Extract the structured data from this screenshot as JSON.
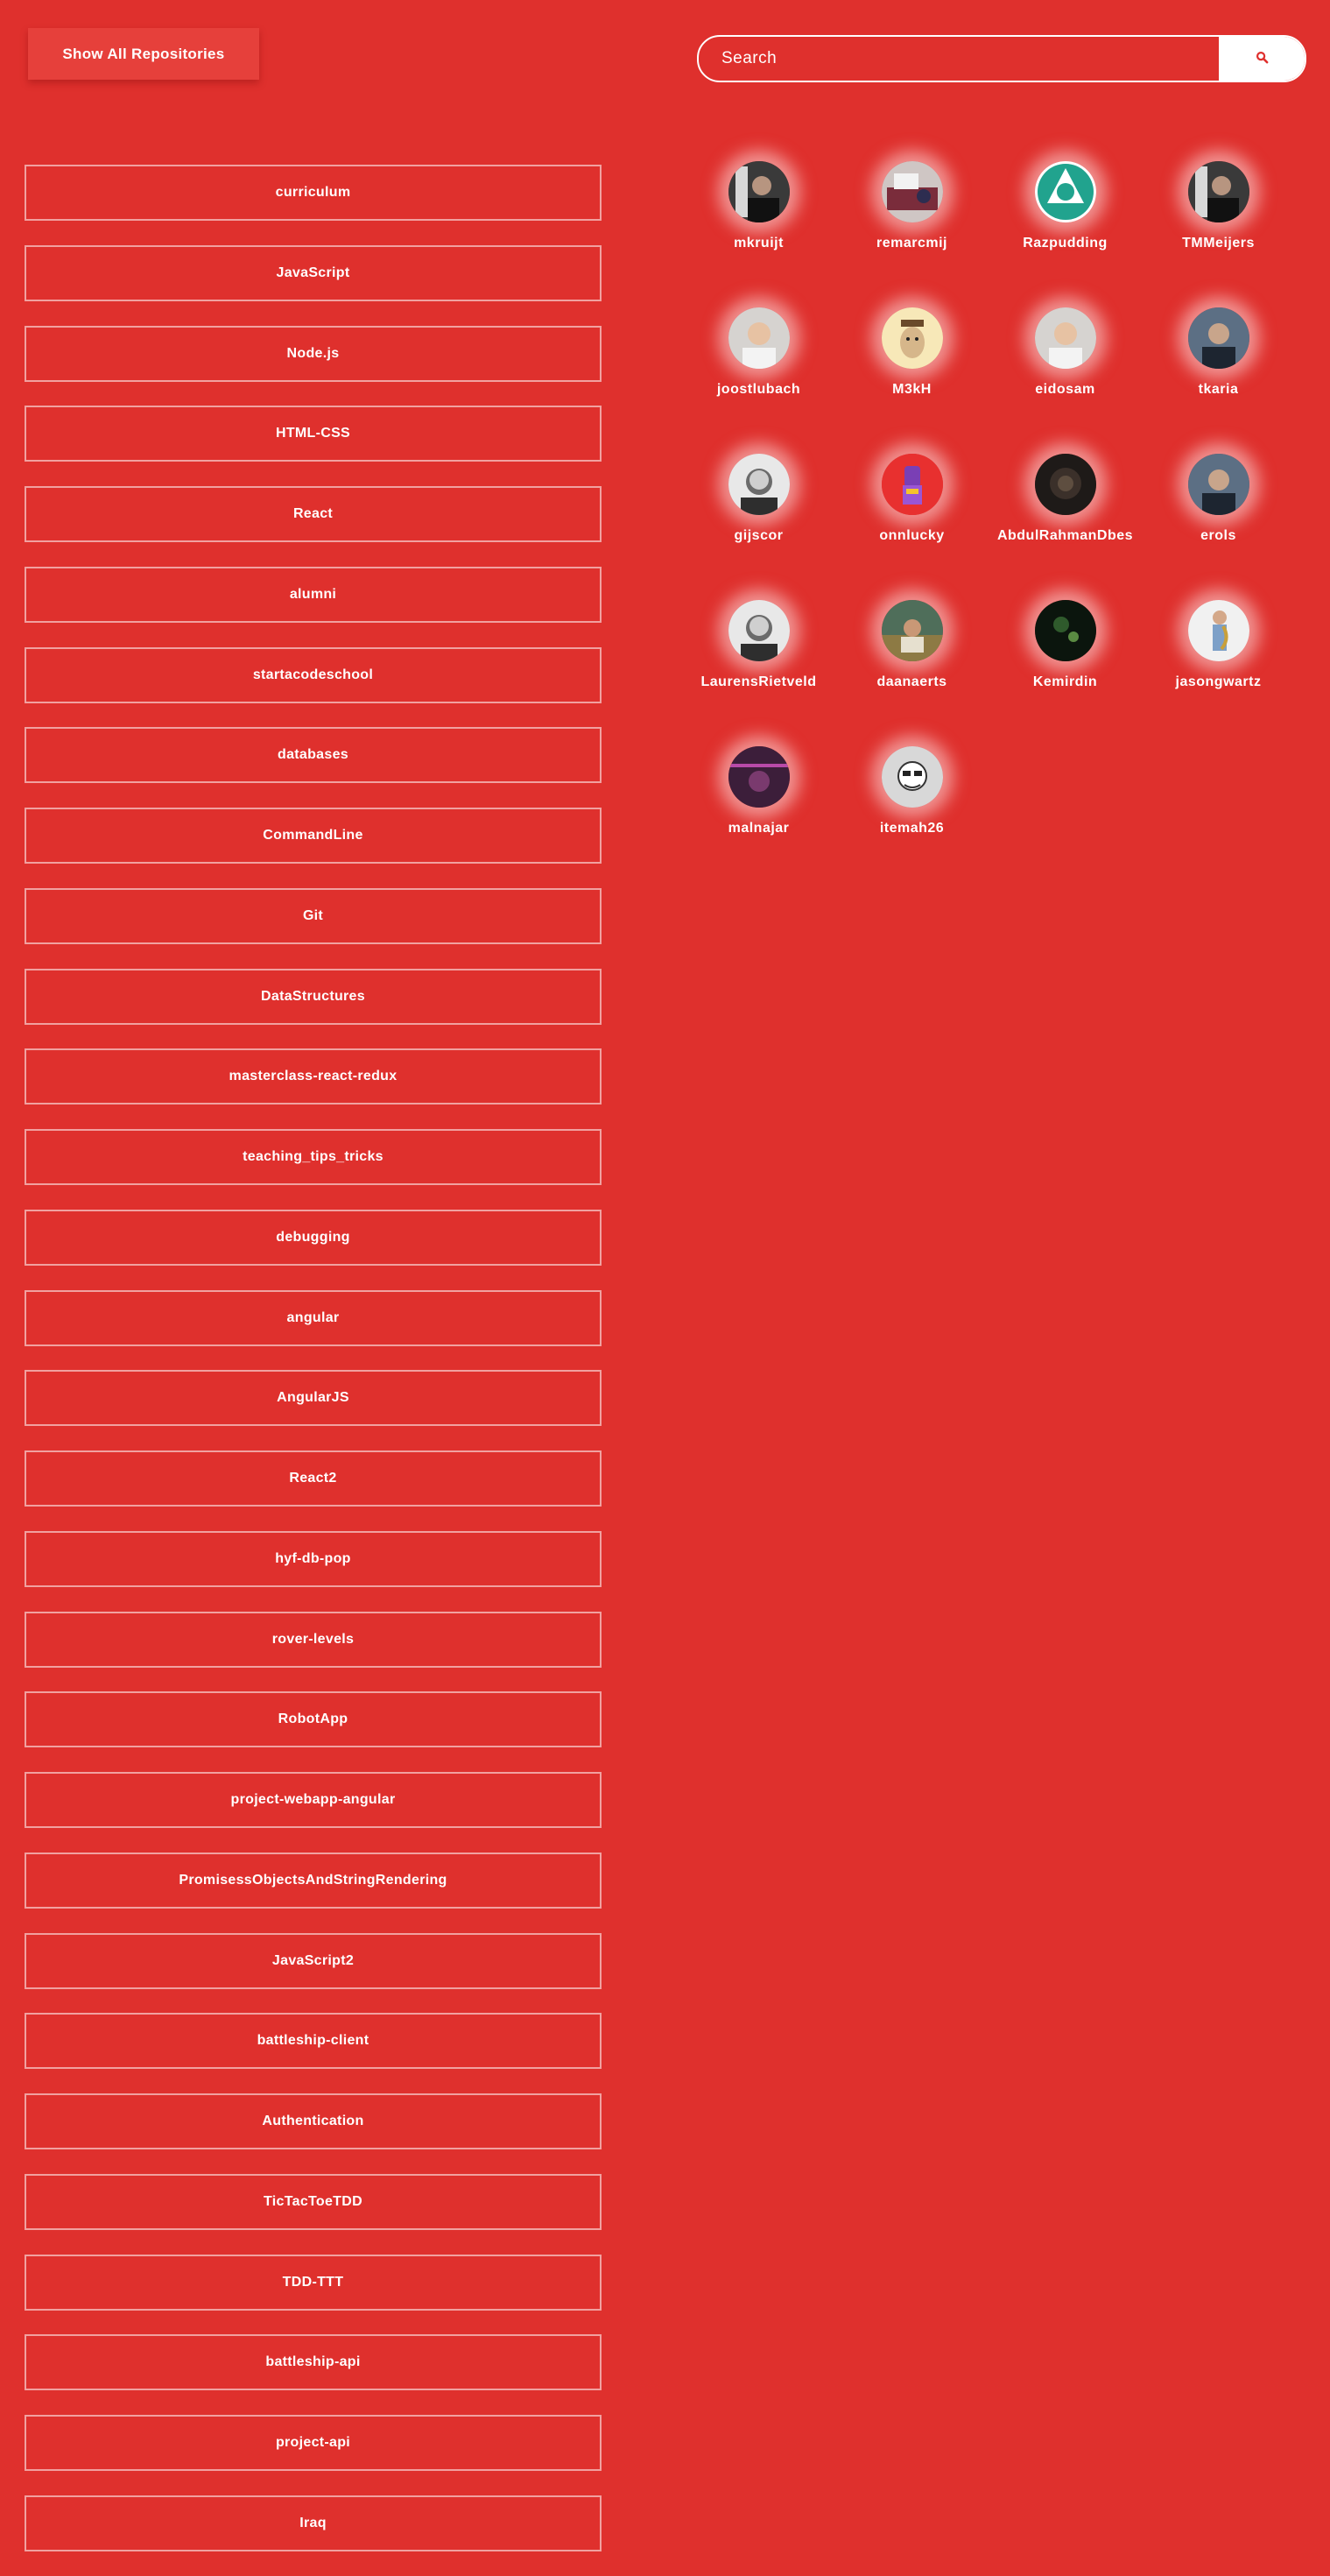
{
  "header": {
    "show_all_label": "Show All Repositories",
    "search": {
      "placeholder": "Search",
      "value": "",
      "button_icon": "search-icon"
    }
  },
  "repositories": [
    {
      "name": "curriculum"
    },
    {
      "name": "JavaScript"
    },
    {
      "name": "Node.js"
    },
    {
      "name": "HTML-CSS"
    },
    {
      "name": "React"
    },
    {
      "name": "alumni"
    },
    {
      "name": "startacodeschool"
    },
    {
      "name": "databases"
    },
    {
      "name": "CommandLine"
    },
    {
      "name": "Git"
    },
    {
      "name": "DataStructures"
    },
    {
      "name": "masterclass-react-redux"
    },
    {
      "name": "teaching_tips_tricks"
    },
    {
      "name": "debugging"
    },
    {
      "name": "angular"
    },
    {
      "name": "AngularJS"
    },
    {
      "name": "React2"
    },
    {
      "name": "hyf-db-pop"
    },
    {
      "name": "rover-levels"
    },
    {
      "name": "RobotApp"
    },
    {
      "name": "project-webapp-angular"
    },
    {
      "name": "PromisessObjectsAndStringRendering"
    },
    {
      "name": "JavaScript2"
    },
    {
      "name": "battleship-client"
    },
    {
      "name": "Authentication"
    },
    {
      "name": "TicTacToeTDD"
    },
    {
      "name": "TDD-TTT"
    },
    {
      "name": "battleship-api"
    },
    {
      "name": "project-api"
    },
    {
      "name": "Iraq"
    }
  ],
  "contributors": [
    {
      "login": "mkruijt",
      "avatar": "person-photo-dark"
    },
    {
      "login": "remarcmij",
      "avatar": "desk-photo"
    },
    {
      "login": "Razpudding",
      "avatar": "teal-logo"
    },
    {
      "login": "TMMeijers",
      "avatar": "person-photo-dark"
    },
    {
      "login": "joostlubach",
      "avatar": "person-photo-light"
    },
    {
      "login": "M3kH",
      "avatar": "cartoon-face"
    },
    {
      "login": "eidosam",
      "avatar": "person-photo-light"
    },
    {
      "login": "tkaria",
      "avatar": "person-photo-blue"
    },
    {
      "login": "gijscor",
      "avatar": "person-photo-bw"
    },
    {
      "login": "onnlucky",
      "avatar": "purple-robot"
    },
    {
      "login": "AbdulRahmanDbes",
      "avatar": "dark-photo"
    },
    {
      "login": "erols",
      "avatar": "person-photo-blue"
    },
    {
      "login": "LaurensRietveld",
      "avatar": "person-photo-bw"
    },
    {
      "login": "daanaerts",
      "avatar": "outdoor-photo"
    },
    {
      "login": "Kemirdin",
      "avatar": "night-photo"
    },
    {
      "login": "jasongwartz",
      "avatar": "saxophone-photo"
    },
    {
      "login": "malnajar",
      "avatar": "purple-photo"
    },
    {
      "login": "itemah26",
      "avatar": "sketch-face"
    }
  ],
  "colors": {
    "background": "#df302d",
    "button": "#e6403b",
    "text": "#ffffff",
    "search_icon": "#df302d"
  }
}
